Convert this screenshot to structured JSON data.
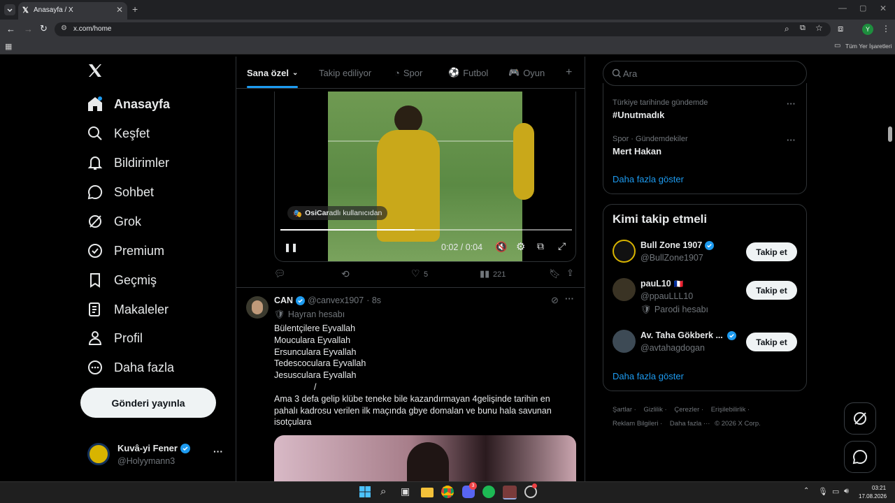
{
  "browser": {
    "tab_title": "Anasayfa / X",
    "url": "x.com/home",
    "bookmarks_label": "Tüm Yer İşaretleri",
    "profile_initial": "Y"
  },
  "nav": {
    "items": [
      {
        "label": "Anasayfa",
        "icon": "home-icon"
      },
      {
        "label": "Keşfet",
        "icon": "search-icon"
      },
      {
        "label": "Bildirimler",
        "icon": "bell-icon"
      },
      {
        "label": "Sohbet",
        "icon": "chat-icon"
      },
      {
        "label": "Grok",
        "icon": "grok-icon"
      },
      {
        "label": "Premium",
        "icon": "verified-icon"
      },
      {
        "label": "Geçmiş",
        "icon": "bookmark-icon"
      },
      {
        "label": "Makaleler",
        "icon": "article-icon"
      },
      {
        "label": "Profil",
        "icon": "person-icon"
      },
      {
        "label": "Daha fazla",
        "icon": "more-circle-icon"
      }
    ],
    "post_button": "Gönderi yayınla",
    "account": {
      "name": "Kuvâ-yi Fener",
      "handle": "@Holyymann3"
    }
  },
  "feed": {
    "tabs": [
      "Sana özel",
      "Takip ediliyor",
      "Spor",
      "Futbol",
      "Oyun"
    ],
    "video": {
      "source_label": "OsiCar",
      "source_suffix": " adlı kullanıcıdan",
      "time": "0:02 / 0:04",
      "progress": 0.46
    },
    "actions": {
      "likes": "5",
      "views": "221"
    },
    "tweet": {
      "name": "CAN",
      "handle": "@canvex1907",
      "time": "· 8s",
      "tag": "Hayran hesabı",
      "lines": [
        "Bülentçilere Eyvallah",
        "Moucular​a Eyvallah",
        "Ersunculara Eyvallah",
        "Tedescoculara Eyvallah",
        "Jesusculara Eyvallah",
        "/",
        "Ama 3 defa gelip klübe teneke bile kazandırmayan 4gelişinde tarihin en",
        "pahalı kadrosu verilen ilk maçında gbye domalan ve bunu hala savunan",
        "isotçulara"
      ]
    }
  },
  "right": {
    "search_placeholder": "Ara",
    "trends": [
      {
        "context": "Türkiye tarihinde gündemde",
        "title": "#Unutmadık"
      },
      {
        "context": "Spor · Gündemdekiler",
        "title": "Mert Hakan"
      }
    ],
    "show_more": "Daha fazla göster",
    "who_to_follow_title": "Kimi takip etmeli",
    "suggestions": [
      {
        "name": "Bull Zone 1907",
        "handle": "@BullZone1907",
        "note": "",
        "flag": ""
      },
      {
        "name": "pauL10",
        "handle": "@ppauLLL10",
        "note": "Parodi hesabı",
        "flag": "🇫🇷"
      },
      {
        "name": "Av. Taha Gökberk ...",
        "handle": "@avtahagdogan",
        "note": "",
        "flag": ""
      }
    ],
    "follow_label": "Takip et",
    "show_more2": "Daha fazla göster",
    "footer": [
      "Şartlar",
      "Gizlilik",
      "Çerezler",
      "Erişilebilirlik",
      "Reklam Bilgileri",
      "Daha fazla ···",
      "© 2026 X Corp."
    ]
  },
  "taskbar": {
    "time": "03:21",
    "date": "17.08.2026",
    "discord_badge": "3"
  },
  "colors": {
    "accent": "#1d9bf0",
    "bg": "#000000",
    "border": "#2f3336"
  }
}
